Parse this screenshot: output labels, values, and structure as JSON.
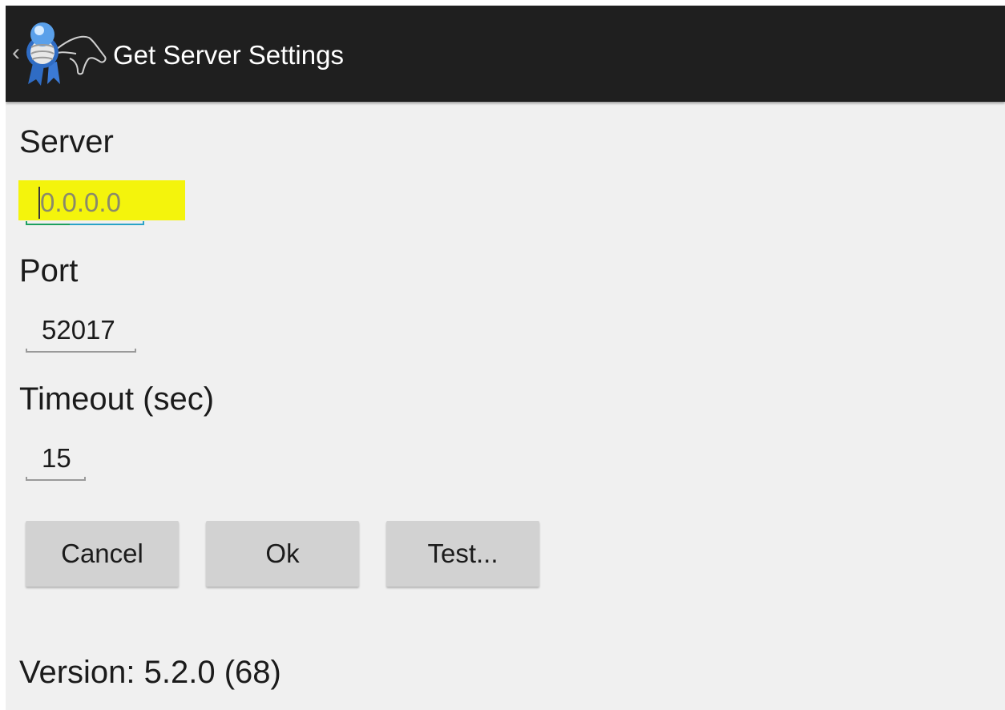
{
  "actionbar": {
    "back_icon": "chevron-left-icon",
    "app_icon": "ribbon-horse-logo-icon",
    "title": "Get Server Settings",
    "background": "#1f1f1f"
  },
  "form": {
    "server": {
      "label": "Server",
      "value": "0.0.0.0",
      "highlight_color": "#f4f40c"
    },
    "port": {
      "label": "Port",
      "value": "52017"
    },
    "timeout": {
      "label": "Timeout (sec)",
      "value": "15"
    }
  },
  "buttons": {
    "cancel": "Cancel",
    "ok": "Ok",
    "test": "Test..."
  },
  "footer": {
    "version": "Version: 5.2.0 (68)"
  }
}
